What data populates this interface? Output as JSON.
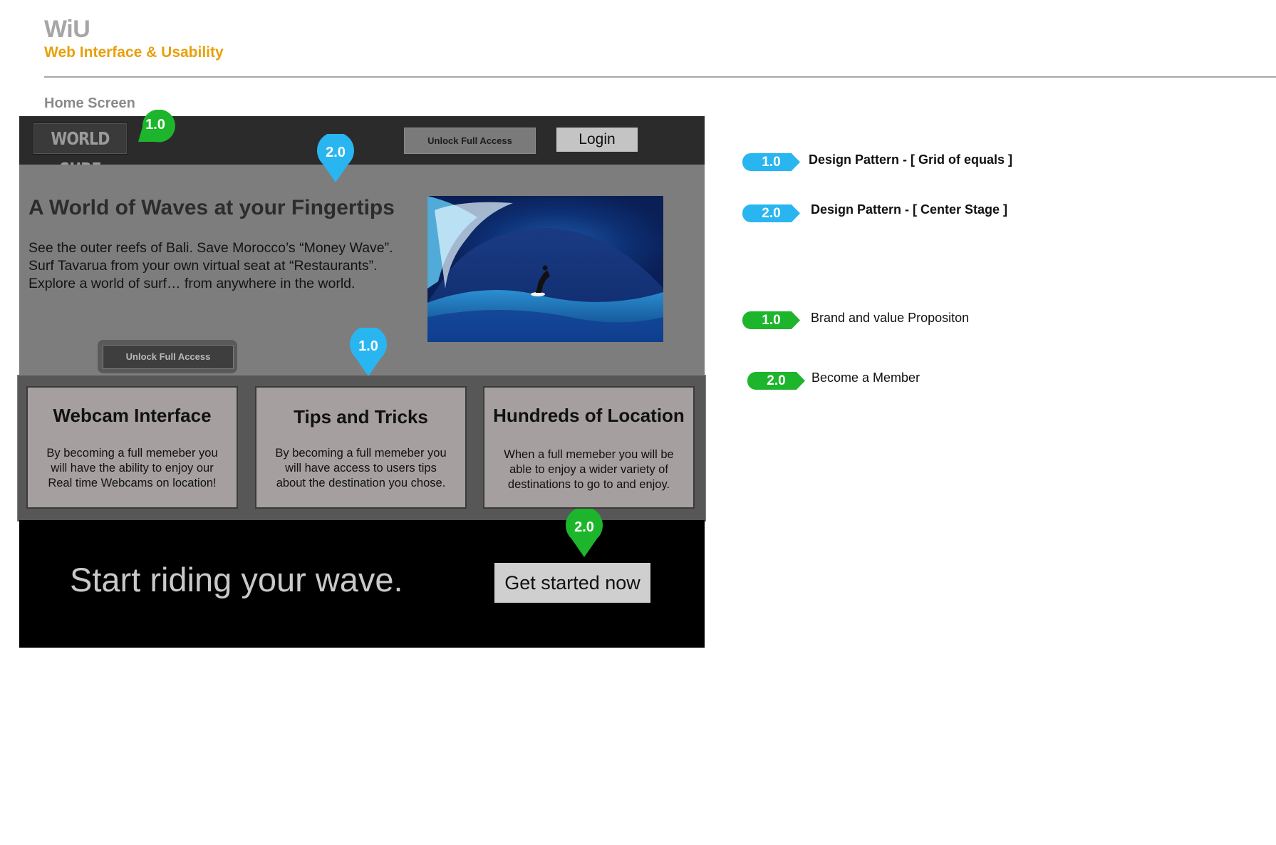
{
  "header": {
    "title": "WiU",
    "subtitle": "Web Interface & Usability",
    "section_label": "Home Screen"
  },
  "mock": {
    "logo": "WORLD SURF",
    "top_unlock_label": "Unlock Full Access",
    "login_label": "Login",
    "hero": {
      "headline": "A World of Waves at your Fingertips",
      "body_lines": [
        "See the outer reefs of Bali. Save Morocco’s “Money Wave”.",
        "Surf Tavarua from your own virtual seat at “Restaurants”.",
        "Explore a world of surf… from anywhere in the world."
      ],
      "unlock_label": "Unlock Full Access"
    },
    "cards": [
      {
        "title": "Webcam Interface",
        "body": "By becoming a full memeber you will have the ability to enjoy our Real time Webcams on location!"
      },
      {
        "title": "Tips and Tricks",
        "body": "By becoming a full memeber you will have access to users tips about the destination you chose."
      },
      {
        "title": "Hundreds of Location",
        "body": "When a full memeber you will be able to enjoy a wider variety of destinations to go to and enjoy."
      }
    ],
    "cta": {
      "text": "Start riding your wave.",
      "button": "Get started now"
    }
  },
  "pins": {
    "logo_pin": "1.0",
    "hero_pin": "2.0",
    "grid_pin": "1.0",
    "cta_pin": "2.0"
  },
  "legend": {
    "blue_1": {
      "tag": "1.0",
      "text": "Design Pattern - [ Grid of equals ]"
    },
    "blue_2": {
      "tag": "2.0",
      "text": "Design Pattern - [ Center Stage ]"
    },
    "green_1": {
      "tag": "1.0",
      "text": "Brand and value Propositon"
    },
    "green_2": {
      "tag": "2.0",
      "text": "Become a Member"
    }
  },
  "colors": {
    "accent_orange": "#e8a00c",
    "pin_blue": "#29b6f0",
    "pin_green": "#1db52b"
  }
}
